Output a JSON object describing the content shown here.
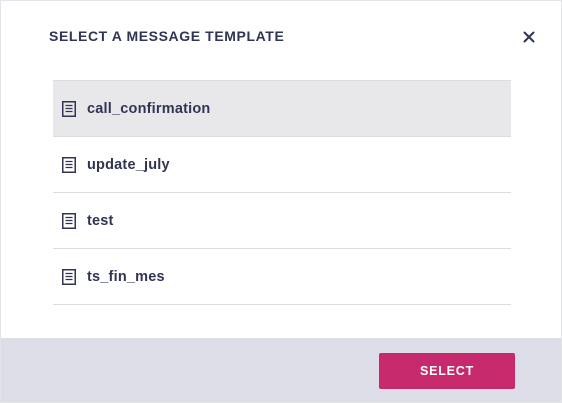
{
  "dialog": {
    "title": "SELECT A MESSAGE TEMPLATE",
    "close_icon": "close-icon"
  },
  "templates": [
    {
      "label": "call_confirmation",
      "icon": "document-icon",
      "selected": true
    },
    {
      "label": "update_july",
      "icon": "document-icon",
      "selected": false
    },
    {
      "label": "test",
      "icon": "document-icon",
      "selected": false
    },
    {
      "label": "ts_fin_mes",
      "icon": "document-icon",
      "selected": false
    }
  ],
  "footer": {
    "select_label": "SELECT"
  },
  "colors": {
    "accent": "#c72a6c",
    "text": "#2f3553",
    "selected_row": "#e8e8eb",
    "footer_bg": "#dddde8"
  }
}
